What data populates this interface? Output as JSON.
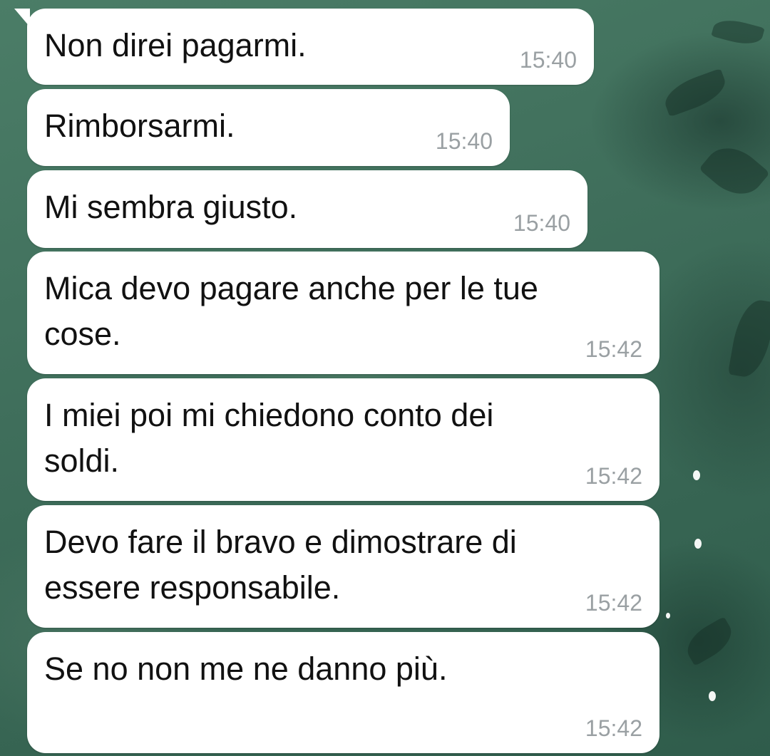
{
  "messages": [
    {
      "text": "Non direi pagarmi.",
      "time": "15:40"
    },
    {
      "text": "Rimborsarmi.",
      "time": "15:40"
    },
    {
      "text": "Mi sembra giusto.",
      "time": "15:40"
    },
    {
      "text": "Mica devo pagare anche per le tue\ncose.",
      "time": "15:42"
    },
    {
      "text": "I miei poi mi chiedono conto dei\nsoldi.",
      "time": "15:42"
    },
    {
      "text": "Devo fare il bravo e dimostrare di\nessere responsabile.",
      "time": "15:42"
    },
    {
      "text": "Se no non me ne danno più.",
      "time": "15:42"
    }
  ],
  "colors": {
    "bubble": "#ffffff",
    "timestamp": "#9aa0a3",
    "wallpaper": "#3f6f5c"
  }
}
